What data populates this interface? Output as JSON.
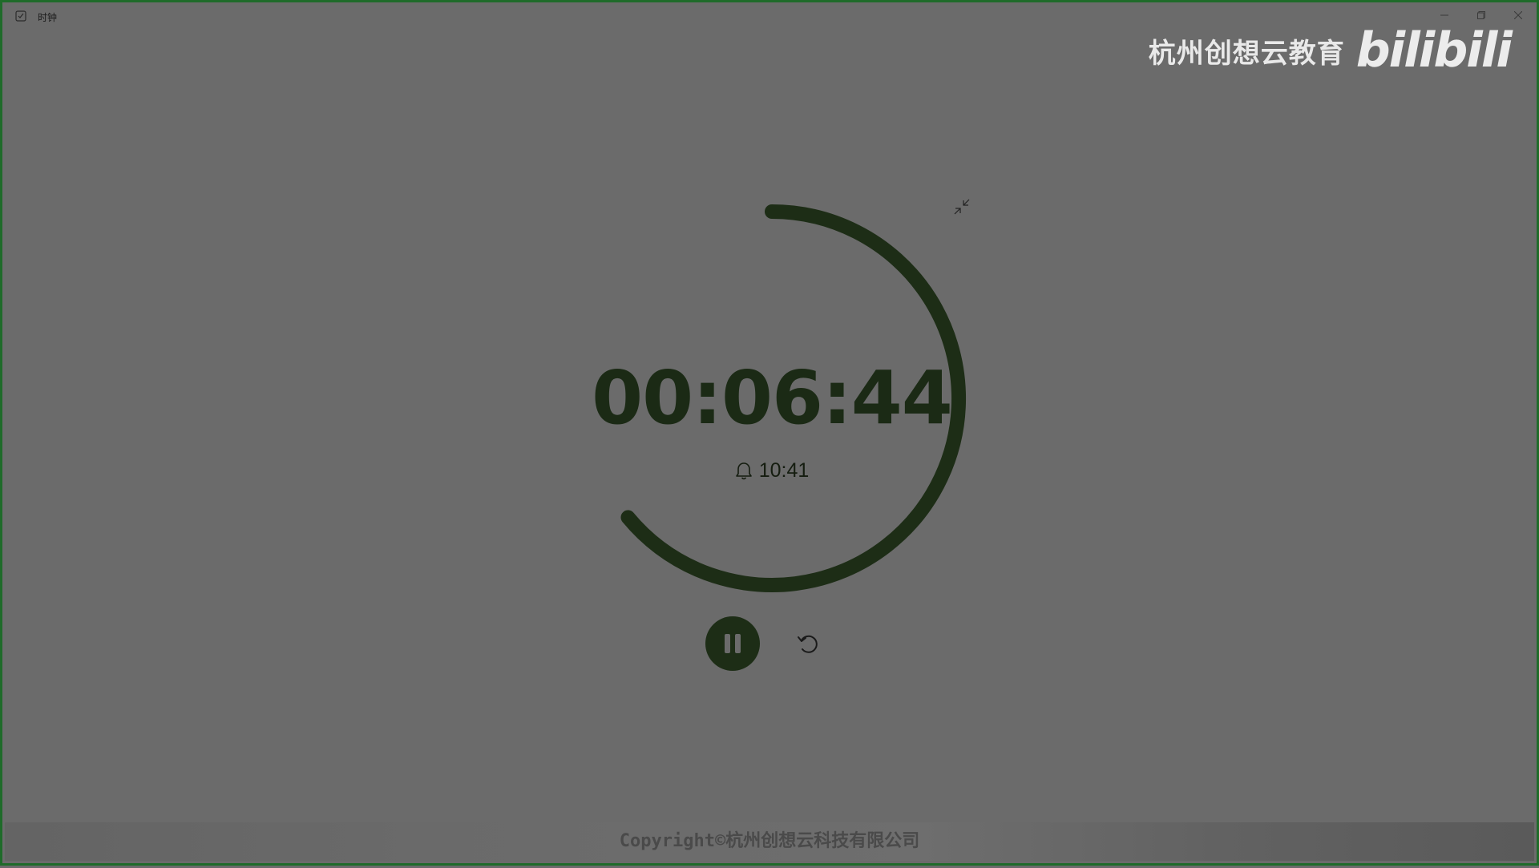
{
  "window": {
    "title": "时钟"
  },
  "watermark": {
    "org": "杭州创想云教育",
    "logo": "bilibili"
  },
  "timer": {
    "remaining": "00:06:44",
    "alarm_time": "10:41",
    "progress": 0.64
  },
  "footer": {
    "copyright": "Copyright©杭州创想云科技有限公司"
  },
  "colors": {
    "background": "#6b6b6b",
    "ring": "#1d2d16",
    "border": "#1f6b2a"
  },
  "icons": {
    "app": "clock-app-icon",
    "minimize": "minimize-icon",
    "maximize": "maximize-icon",
    "close": "close-icon",
    "collapse": "collapse-icon",
    "alarm": "bell-icon",
    "pause": "pause-icon",
    "reset": "reset-icon"
  }
}
